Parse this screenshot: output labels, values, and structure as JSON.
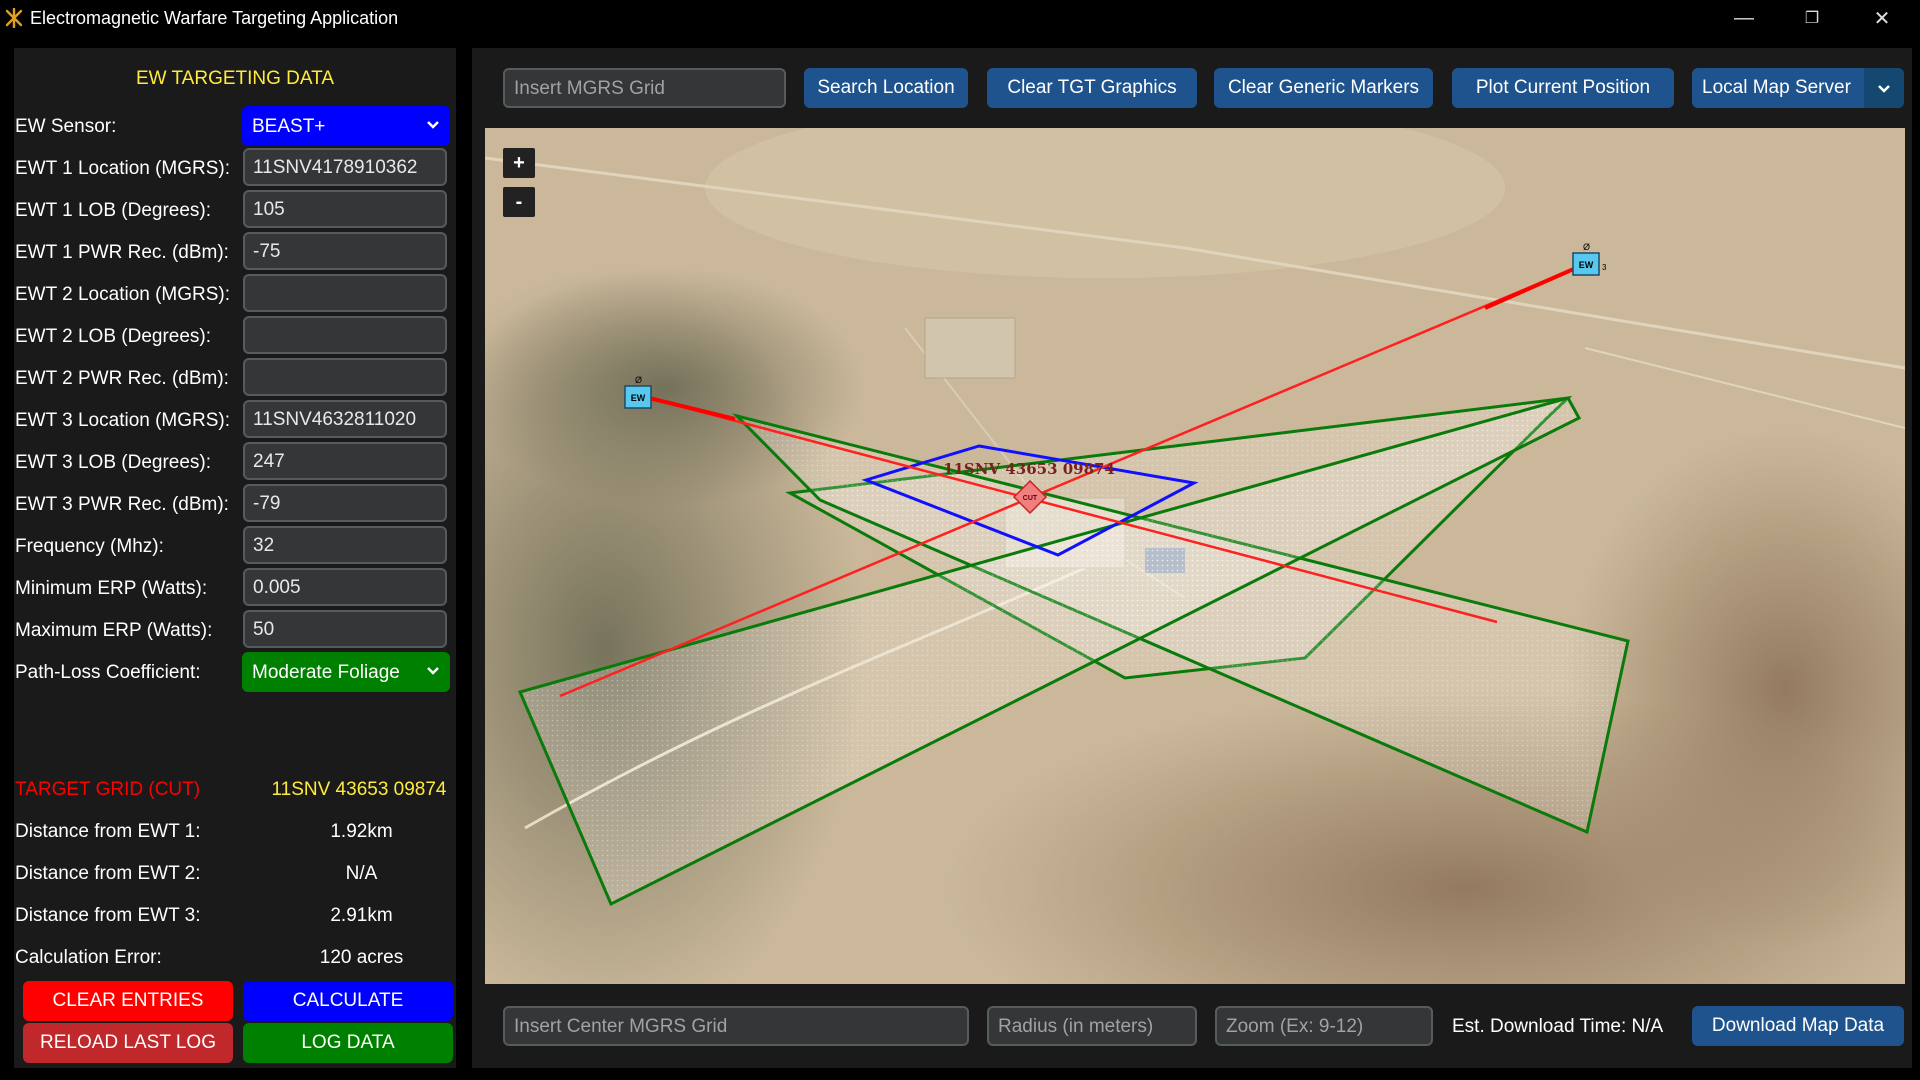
{
  "window": {
    "title": "Electromagnetic Warfare Targeting Application",
    "minimize": "—",
    "restore": "❐",
    "close": "✕"
  },
  "left_panel": {
    "header": "EW TARGETING DATA",
    "sensor": {
      "label": "EW Sensor:",
      "value": "BEAST+",
      "color": "#0000ff"
    },
    "fields": [
      {
        "label": "EWT 1 Location (MGRS):",
        "value": "11SNV4178910362"
      },
      {
        "label": "EWT 1 LOB (Degrees):",
        "value": "105"
      },
      {
        "label": "EWT 1 PWR Rec. (dBm):",
        "value": "-75"
      },
      {
        "label": "EWT 2 Location (MGRS):",
        "value": ""
      },
      {
        "label": "EWT 2 LOB (Degrees):",
        "value": ""
      },
      {
        "label": "EWT 2 PWR Rec. (dBm):",
        "value": ""
      },
      {
        "label": "EWT 3 Location (MGRS):",
        "value": "11SNV4632811020"
      },
      {
        "label": "EWT 3 LOB (Degrees):",
        "value": "247"
      },
      {
        "label": "EWT 3 PWR Rec. (dBm):",
        "value": "-79"
      },
      {
        "label": "Frequency (Mhz):",
        "value": "32"
      },
      {
        "label": "Minimum ERP (Watts):",
        "value": "0.005"
      },
      {
        "label": "Maximum ERP (Watts):",
        "value": "50"
      }
    ],
    "path_loss": {
      "label": "Path-Loss Coefficient:",
      "value": "Moderate Foliage",
      "color": "#008000"
    },
    "target": {
      "label": "TARGET GRID (CUT)",
      "value": "11SNV 43653 09874",
      "label_color": "#ff0000",
      "value_color": "#ffeb3b"
    },
    "results": [
      {
        "label": "Distance from EWT 1:",
        "value": "1.92km"
      },
      {
        "label": "Distance from EWT 2:",
        "value": "N/A"
      },
      {
        "label": "Distance from EWT 3:",
        "value": "2.91km"
      },
      {
        "label": "Calculation Error:",
        "value": "120 acres"
      }
    ],
    "buttons": {
      "clear_entries": "CLEAR ENTRIES",
      "calculate": "CALCULATE",
      "reload_last_log": "RELOAD LAST LOG",
      "log_data": "LOG DATA"
    },
    "colors": {
      "clear": "#ff0000",
      "calculate": "#0000ff",
      "reload": "#c0282b",
      "log": "#008000"
    }
  },
  "toolbar": {
    "mgrs_placeholder": "Insert MGRS Grid",
    "search_location": "Search Location",
    "clear_tgt_graphics": "Clear TGT Graphics",
    "clear_generic_markers": "Clear Generic Markers",
    "plot_current_position": "Plot Current Position",
    "map_server": "Local Map Server"
  },
  "map": {
    "zoom_in": "+",
    "zoom_out": "-",
    "target_label": "11SNV 43653 09874",
    "cut_marker": "CUT",
    "ewt1_marker": "EW",
    "ewt3_marker": "EW",
    "ewt3_number": "3",
    "colors": {
      "lob": "#ff2020",
      "cone": "#0a7a0a",
      "cut": "#1010ff",
      "marker": "#58c8ee"
    }
  },
  "download": {
    "center_placeholder": "Insert Center MGRS Grid",
    "radius_placeholder": "Radius (in meters)",
    "zoom_placeholder": "Zoom (Ex: 9-12)",
    "est_time": "Est. Download Time: N/A",
    "download_button": "Download Map Data"
  }
}
